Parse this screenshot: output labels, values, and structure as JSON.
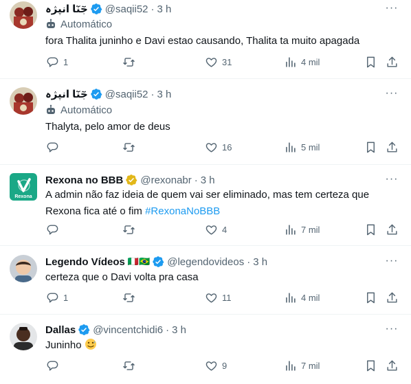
{
  "tweets": [
    {
      "display_name": "جٓنٓا انپژہ",
      "handle": "@saqii52",
      "separator": "·",
      "time": "3 h",
      "automated_label": "Automático",
      "text": "fora Thalita juninho e Davi estao causando, Thalita ta muito apagada",
      "replies": "1",
      "retweets": "",
      "likes": "31",
      "views": "4 mil"
    },
    {
      "display_name": "جٓنٓا انپژہ",
      "handle": "@saqii52",
      "separator": "·",
      "time": "3 h",
      "automated_label": "Automático",
      "text": "Thalyta, pelo amor de deus",
      "replies": "",
      "retweets": "",
      "likes": "16",
      "views": "5 mil"
    },
    {
      "display_name": "Rexona no BBB",
      "handle": "@rexonabr",
      "separator": "·",
      "time": "3 h",
      "text": "A admin não faz ideia de quem vai ser eliminado, mas tem certeza que Rexona fica até o fim",
      "hashtag": "#RexonaNoBBB",
      "avatar_text": "Rexona",
      "replies": "",
      "retweets": "",
      "likes": "4",
      "views": "7 mil"
    },
    {
      "display_name": "Legendo Vídeos",
      "flags": "🇮🇹🇧🇷",
      "handle": "@legendovideos",
      "separator": "·",
      "time": "3 h",
      "text": "certeza que o Davi volta pra casa",
      "replies": "1",
      "retweets": "",
      "likes": "11",
      "views": "4 mil"
    },
    {
      "display_name": "Dallas",
      "handle": "@vincentchidi6",
      "separator": "·",
      "time": "3 h",
      "text": "Juninho",
      "replies": "",
      "retweets": "",
      "likes": "9",
      "views": "7 mil"
    }
  ],
  "more_glyph": "···",
  "colors": {
    "verified_blue": "#1d9bf0",
    "verified_gold": "#e2b719",
    "secondary_text": "#536471",
    "primary_text": "#0f1419",
    "rexona_green": "#1aa886"
  },
  "icons": [
    "reply-icon",
    "retweet-icon",
    "like-icon",
    "views-icon",
    "bookmark-icon",
    "share-icon",
    "more-icon",
    "verified-badge-icon",
    "automated-bot-icon"
  ]
}
